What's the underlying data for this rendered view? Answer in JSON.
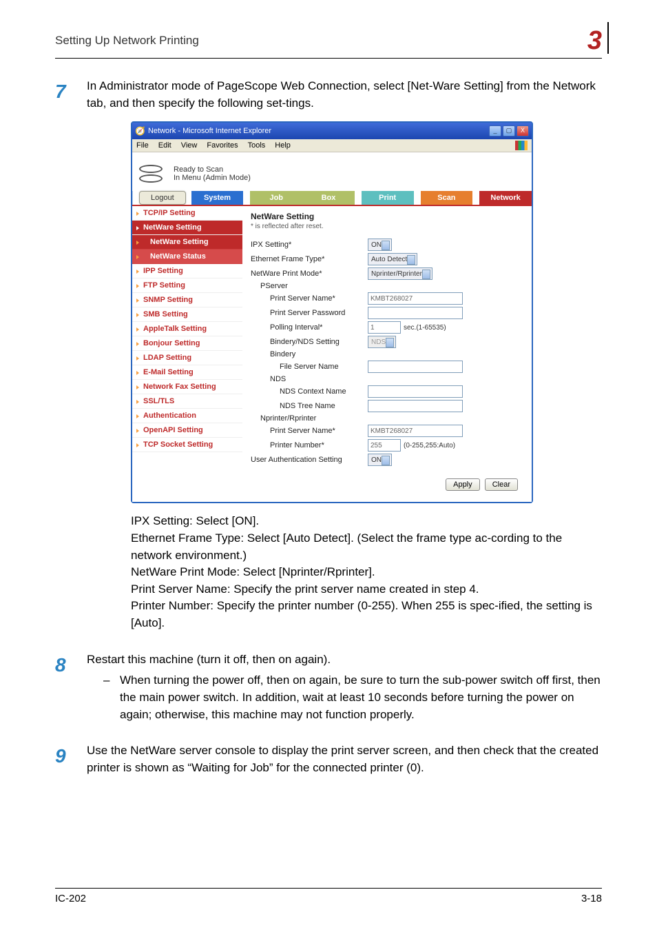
{
  "header": {
    "section_title": "Setting Up Network Printing",
    "chapter_number": "3"
  },
  "steps": {
    "s7": {
      "num": "7",
      "text": "In Administrator mode of PageScope Web Connection, select [Net-Ware Setting] from the Network tab, and then specify the following set-tings."
    },
    "s8": {
      "num": "8",
      "text": "Restart this machine (turn it off, then on again).",
      "bullet_dash": "–",
      "bullet_text": "When turning the power off, then on again, be sure to turn the sub-power switch off first, then the main power switch. In addition, wait at least 10 seconds before turning the power on again; otherwise, this machine may not function properly."
    },
    "s9": {
      "num": "9",
      "text": "Use the NetWare server console to display the print server screen, and then check that the created printer is shown as “Waiting for Job” for the connected printer (0)."
    }
  },
  "after_shot_lines": {
    "l1": "IPX Setting: Select [ON].",
    "l2": "Ethernet Frame Type: Select [Auto Detect]. (Select the frame type ac-cording to the network environment.)",
    "l3": "NetWare Print Mode: Select [Nprinter/Rprinter].",
    "l4": "Print Server Name: Specify the print server name created in step 4.",
    "l5": "Printer Number: Specify the printer number (0-255). When 255 is spec-ified, the setting is [Auto]."
  },
  "screenshot": {
    "titlebar": {
      "ie_icon_label": "🧭",
      "title": "Network - Microsoft Internet Explorer",
      "btn_min": "_",
      "btn_max": "▢",
      "btn_close": "X"
    },
    "menubar": [
      "File",
      "Edit",
      "View",
      "Favorites",
      "Tools",
      "Help"
    ],
    "status": {
      "line1": "Ready to Scan",
      "line2": "In Menu (Admin Mode)"
    },
    "tabs": {
      "logout": "Logout",
      "system": "System",
      "job": "Job",
      "box": "Box",
      "print": "Print",
      "scan": "Scan",
      "network": "Network"
    },
    "sidebar": {
      "items": [
        {
          "label": "TCP/IP Setting"
        },
        {
          "label": "NetWare Setting",
          "active": true
        },
        {
          "label": "NetWare Setting",
          "sub": true,
          "sel": true
        },
        {
          "label": "NetWare Status",
          "sub": true
        },
        {
          "label": "IPP Setting"
        },
        {
          "label": "FTP Setting"
        },
        {
          "label": "SNMP Setting"
        },
        {
          "label": "SMB Setting"
        },
        {
          "label": "AppleTalk Setting"
        },
        {
          "label": "Bonjour Setting"
        },
        {
          "label": "LDAP Setting"
        },
        {
          "label": "E-Mail Setting"
        },
        {
          "label": "Network Fax Setting"
        },
        {
          "label": "SSL/TLS"
        },
        {
          "label": "Authentication"
        },
        {
          "label": "OpenAPI Setting"
        },
        {
          "label": "TCP Socket Setting"
        }
      ]
    },
    "panel": {
      "title": "NetWare Setting",
      "note": "* is reflected after reset.",
      "rows": {
        "ipx": {
          "label": "IPX Setting*",
          "value": "ON"
        },
        "frame": {
          "label": "Ethernet Frame Type*",
          "value": "Auto Detect"
        },
        "mode": {
          "label": "NetWare Print Mode*",
          "value": "Nprinter/Rprinter"
        },
        "pserver": {
          "label": "PServer"
        },
        "psname": {
          "label": "Print Server Name*",
          "value": "KMBT268027"
        },
        "pspass": {
          "label": "Print Server Password",
          "value": ""
        },
        "poll": {
          "label": "Polling Interval*",
          "value": "1",
          "unit": "sec.(1-65535)"
        },
        "bindnds": {
          "label": "Bindery/NDS Setting",
          "value": "NDS"
        },
        "bindery": {
          "label": "Bindery"
        },
        "fsname": {
          "label": "File Server Name",
          "value": ""
        },
        "nds": {
          "label": "NDS"
        },
        "ndsctx": {
          "label": "NDS Context Name",
          "value": ""
        },
        "ndstree": {
          "label": "NDS Tree Name",
          "value": ""
        },
        "npr": {
          "label": "Nprinter/Rprinter"
        },
        "npr_ps": {
          "label": "Print Server Name*",
          "value": "KMBT268027"
        },
        "npr_num": {
          "label": "Printer Number*",
          "value": "255",
          "unit": "(0-255,255:Auto)"
        },
        "uauth": {
          "label": "User Authentication Setting",
          "value": "ON"
        }
      },
      "buttons": {
        "apply": "Apply",
        "clear": "Clear"
      }
    }
  },
  "footer": {
    "left": "IC-202",
    "right": "3-18"
  }
}
